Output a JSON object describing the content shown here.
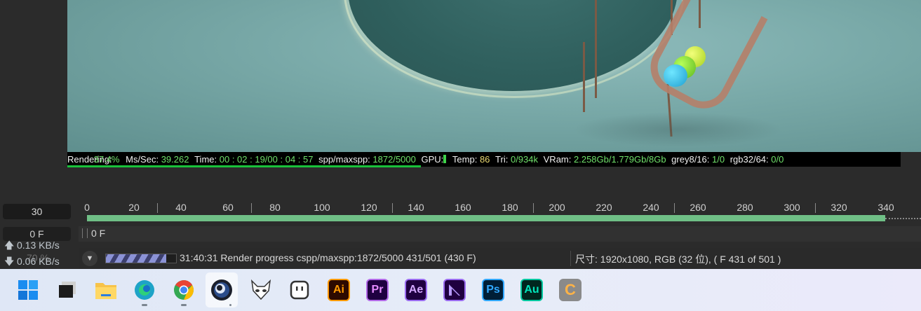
{
  "render_stats": {
    "status_label": "Rendering:",
    "percent": "37.4%",
    "ms_label": "Ms/Sec:",
    "ms_value": "39.262",
    "time_label": "Time:",
    "time_value": "00 : 02 : 19/00 : 04 : 57",
    "spp_label": "spp/maxspp:",
    "spp_value": "1872/5000",
    "gpu_label": "GPU:",
    "temp_label": "Temp:",
    "temp_value": "86",
    "tri_label": "Tri:",
    "tri_value": "0/934k",
    "vram_label": "VRam:",
    "vram_value": "2.258Gb/1.779Gb/8Gb",
    "grey_label": "grey8/16:",
    "grey_value": "1/0",
    "rgb_label": "rgb32/64:",
    "rgb_value": "0/0",
    "progress_fraction": 0.374
  },
  "timeline": {
    "fps_value": "30",
    "current_frame": "0 F",
    "track_frame_label": "0 F",
    "ruler_labels": [
      "0",
      "20",
      "40",
      "60",
      "80",
      "100",
      "120",
      "140",
      "160",
      "180",
      "200",
      "220",
      "240",
      "260",
      "280",
      "300",
      "320",
      "340"
    ]
  },
  "network": {
    "upload": "0.13 KB/s",
    "download": "0.06 KB/s",
    "zoom_ghost": "70 %"
  },
  "status_bar": {
    "progress_fraction": 0.86,
    "render_status": "31:40:31 Render progress  cspp/maxspp:1872/5000 431/501 (430 F)",
    "image_info": "尺寸: 1920x1080, RGB (32 位), ( F 431 of 501 )"
  },
  "taskbar": {
    "icons": [
      {
        "name": "windows-start-icon"
      },
      {
        "name": "task-view-icon"
      },
      {
        "name": "file-explorer-icon"
      },
      {
        "name": "edge-browser-icon"
      },
      {
        "name": "chrome-browser-icon"
      },
      {
        "name": "cinema4d-icon"
      },
      {
        "name": "alien-app-icon"
      },
      {
        "name": "robot-app-icon"
      },
      {
        "name": "illustrator-icon",
        "text": "Ai"
      },
      {
        "name": "premiere-icon",
        "text": "Pr"
      },
      {
        "name": "after-effects-icon",
        "text": "Ae"
      },
      {
        "name": "media-encoder-icon"
      },
      {
        "name": "photoshop-icon",
        "text": "Ps"
      },
      {
        "name": "audition-icon",
        "text": "Au"
      },
      {
        "name": "c-app-icon",
        "text": "C"
      }
    ]
  },
  "colors": {
    "stat_green": "#6fe06a",
    "stat_yellow": "#e8d870",
    "timeline_green": "#6fbf86",
    "progress_purple": "#8b92d6"
  }
}
